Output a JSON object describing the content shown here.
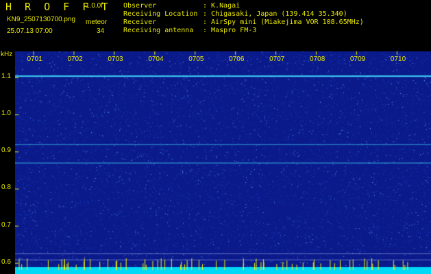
{
  "header": {
    "app_title": "H R O F F T",
    "version": "1.0.0f",
    "filename": "KN9_2507130700.png",
    "meteor_label": "meteor",
    "datetime": "25.07.13 07:00",
    "meteor_count": "34",
    "meta": [
      {
        "key": "Observer",
        "value": ": K.Nagai"
      },
      {
        "key": "Receiving Location",
        "value": ": Chigasaki, Japan (139.414 35.340)"
      },
      {
        "key": "Receiver",
        "value": ": AirSpy mini (Miakejima VOR 108.65MHz)"
      },
      {
        "key": "Receiving antenna",
        "value": ": Maspro FM-3"
      }
    ]
  },
  "chart_data": {
    "type": "heatmap",
    "ylabel": "kHz",
    "y_ticks": [
      "1.1",
      "1.0",
      "0.9",
      "0.8",
      "0.7",
      "0.6"
    ],
    "y_tick_values": [
      1.1,
      1.0,
      0.9,
      0.8,
      0.7,
      0.6
    ],
    "ylim": [
      0.57,
      1.17
    ],
    "x_ticks": [
      "0701",
      "0702",
      "0703",
      "0704",
      "0705",
      "0706",
      "0707",
      "0708",
      "0709",
      "0710"
    ],
    "x_tick_values": [
      1,
      2,
      3,
      4,
      5,
      6,
      7,
      8,
      9,
      10
    ],
    "xlim": [
      0.55,
      10.85
    ],
    "horizontal_lines_khz": [
      1.105,
      0.92,
      0.87
    ],
    "colors": {
      "background": "#0a1a8a",
      "signal": "#40e0ff",
      "noise_floor": "#00d8f8",
      "ticks": "#e8e800"
    }
  }
}
